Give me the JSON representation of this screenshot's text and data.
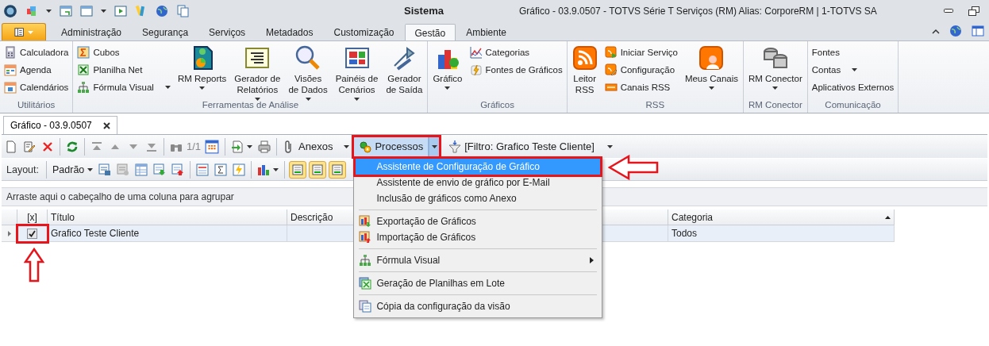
{
  "title_bar": {
    "app_title": "Sistema",
    "window_title": "Gráfico - 03.9.0507 - TOTVS Série T Serviços (RM) Alias: CorporeRM | 1-TOTVS SA"
  },
  "ribbon": {
    "tabs": [
      {
        "label": "Administração",
        "selected": false
      },
      {
        "label": "Segurança",
        "selected": false
      },
      {
        "label": "Serviços",
        "selected": false
      },
      {
        "label": "Metadados",
        "selected": false
      },
      {
        "label": "Customização",
        "selected": false
      },
      {
        "label": "Gestão",
        "selected": true
      },
      {
        "label": "Ambiente",
        "selected": false
      }
    ],
    "groups": [
      {
        "label": "Utilitários",
        "columns": [
          {
            "kind": "stack",
            "items": [
              {
                "label": "Calculadora",
                "dropdown": false
              },
              {
                "label": "Agenda",
                "dropdown": false
              },
              {
                "label": "Calendários",
                "dropdown": false
              }
            ]
          }
        ]
      },
      {
        "label": "Ferramentas de Análise",
        "columns": [
          {
            "kind": "stack",
            "items": [
              {
                "label": "Cubos",
                "dropdown": false
              },
              {
                "label": "Planilha Net",
                "dropdown": false
              },
              {
                "label": "Fórmula Visual",
                "dropdown": true
              }
            ]
          },
          {
            "kind": "large",
            "label": "RM Reports",
            "dropdown": true
          },
          {
            "kind": "large",
            "label": "Gerador de\nRelatórios",
            "dropdown": true
          },
          {
            "kind": "large",
            "label": "Visões\nde Dados",
            "dropdown": true
          },
          {
            "kind": "large",
            "label": "Painéis de\nCenários",
            "dropdown": true
          },
          {
            "kind": "large",
            "label": "Gerador\nde Saída",
            "dropdown": false
          }
        ]
      },
      {
        "label": "Gráficos",
        "columns": [
          {
            "kind": "large",
            "label": "Gráfico",
            "dropdown": true
          },
          {
            "kind": "stack",
            "items": [
              {
                "label": "Categorias",
                "dropdown": false
              },
              {
                "label": "Fontes de Gráficos",
                "dropdown": false
              }
            ]
          }
        ]
      },
      {
        "label": "RSS",
        "columns": [
          {
            "kind": "large",
            "label": "Leitor\nRSS",
            "dropdown": false
          },
          {
            "kind": "stack",
            "items": [
              {
                "label": "Iniciar Serviço",
                "dropdown": false
              },
              {
                "label": "Configuração",
                "dropdown": false
              },
              {
                "label": "Canais RSS",
                "dropdown": false
              }
            ]
          },
          {
            "kind": "large",
            "label": "Meus Canais",
            "dropdown": true
          }
        ]
      },
      {
        "label": "RM Conector",
        "columns": [
          {
            "kind": "large",
            "label": "RM Conector",
            "dropdown": true
          }
        ]
      },
      {
        "label": "Comunicação",
        "columns": [
          {
            "kind": "text",
            "items": [
              {
                "label": "Fontes",
                "dropdown": false
              },
              {
                "label": "Contas",
                "dropdown": true
              },
              {
                "label": "Aplicativos Externos",
                "dropdown": false
              }
            ]
          }
        ]
      }
    ]
  },
  "document_tab": {
    "label": "Gráfico - 03.9.0507"
  },
  "toolbar": {
    "record_counter": "1/1",
    "attachments": "Anexos",
    "processes": {
      "label": "Processos",
      "open": true,
      "annotated": true
    },
    "filter": "[Filtro: Grafico Teste Cliente]"
  },
  "layout_bar": {
    "label": "Layout:",
    "preset": "Padrão"
  },
  "group_panel": "Arraste aqui o cabeçalho de uma coluna para agrupar",
  "grid": {
    "columns": [
      {
        "label": "[x]",
        "sorted": false
      },
      {
        "label": "Título",
        "sorted": false
      },
      {
        "label": "Descrição",
        "sorted": false
      },
      {
        "label": "Categoria",
        "sorted": true
      }
    ],
    "rows": [
      {
        "checked": true,
        "annotated": true,
        "cells": [
          "",
          "Grafico Teste Cliente",
          "",
          "Todos"
        ]
      }
    ]
  },
  "menu": {
    "sections": [
      [
        {
          "label": "Assistente de Configuração de Gráfico",
          "selected": true,
          "annotated": true,
          "submenu": false
        },
        {
          "label": "Assistente de envio de gráfico por E-Mail",
          "selected": false,
          "annotated": false,
          "submenu": false
        },
        {
          "label": "Inclusão de gráficos como Anexo",
          "selected": false,
          "annotated": false,
          "submenu": false
        }
      ],
      [
        {
          "label": "Exportação de Gráficos",
          "selected": false,
          "annotated": false,
          "submenu": false
        },
        {
          "label": "Importação de Gráficos",
          "selected": false,
          "annotated": false,
          "submenu": false
        }
      ],
      [
        {
          "label": "Fórmula Visual",
          "selected": false,
          "annotated": false,
          "submenu": true
        }
      ],
      [
        {
          "label": "Geração de Planilhas em Lote",
          "selected": false,
          "annotated": false,
          "submenu": false
        }
      ],
      [
        {
          "label": "Cópia da configuração da visão",
          "selected": false,
          "annotated": false,
          "submenu": false
        }
      ]
    ]
  }
}
